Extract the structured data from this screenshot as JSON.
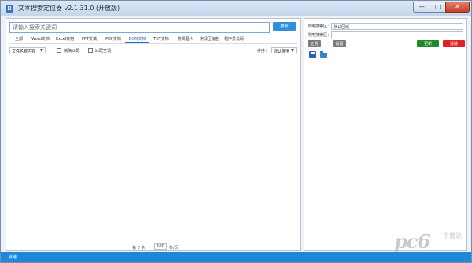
{
  "window": {
    "title": "文本搜索定位器 v2.1.31.0 (开放版)",
    "controls": {
      "minimize": "—",
      "maximize": "□",
      "close": "✕"
    }
  },
  "search": {
    "placeholder": "请输入搜索关键词",
    "button_label": "搜索"
  },
  "tabs": [
    {
      "label": "全部",
      "active": false
    },
    {
      "label": "Word文档",
      "active": false
    },
    {
      "label": "Excel表格",
      "active": false
    },
    {
      "label": "PPT文稿",
      "active": false
    },
    {
      "label": "PDF文档",
      "active": false
    },
    {
      "label": "DOM文档",
      "active": true
    },
    {
      "label": "TXT文档",
      "active": false
    },
    {
      "label": "常规图片",
      "active": false
    },
    {
      "label": "常规压缩包",
      "active": false
    },
    {
      "label": "程序员代码",
      "active": false
    }
  ],
  "filters": {
    "name_filter": "文件名称内容",
    "exact_match_label": "精确匹配",
    "full_match_label": "匹配全词",
    "sort_label": "排序：",
    "sort_value": "默认排序"
  },
  "pager": {
    "prefix": "第 0 条",
    "page_size": "100",
    "suffix": "条/页"
  },
  "right_panel": {
    "enabled_label": "启用搜索区：",
    "enabled_value": "默认区域",
    "common_label": "常用搜索区：",
    "common_value": "",
    "btn_positive": "正则",
    "btn_settings": "设置",
    "btn_update": "更新",
    "btn_clear": "清除"
  },
  "status": {
    "text": "就绪"
  },
  "watermark": {
    "logo": "pc6",
    "text": "下载站"
  },
  "colors": {
    "accent": "#2f8fdc",
    "status_bar": "#1e88d8",
    "btn_green": "#1f8a2a",
    "btn_red": "#e02222",
    "btn_gray": "#7a7a7a"
  }
}
